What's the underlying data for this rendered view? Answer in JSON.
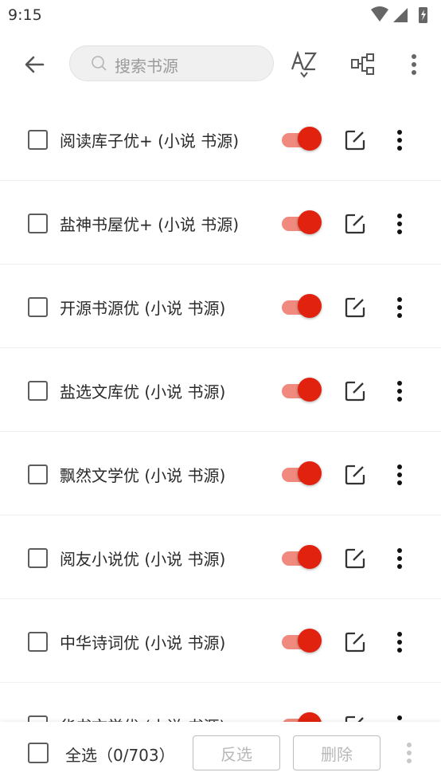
{
  "status_bar": {
    "time": "9:15"
  },
  "toolbar": {
    "search_placeholder": "搜索书源"
  },
  "sources": [
    {
      "name": "阅读库子优+ (小说 书源)",
      "enabled": true
    },
    {
      "name": "盐神书屋优+ (小说 书源)",
      "enabled": true
    },
    {
      "name": "开源书源优 (小说 书源)",
      "enabled": true
    },
    {
      "name": "盐选文库优 (小说 书源)",
      "enabled": true
    },
    {
      "name": "飘然文学优 (小说 书源)",
      "enabled": true
    },
    {
      "name": "阅友小说优 (小说 书源)",
      "enabled": true
    },
    {
      "name": "中华诗词优 (小说 书源)",
      "enabled": true
    },
    {
      "name": "华书文学优 (小说 书源)",
      "enabled": true
    }
  ],
  "bottom_bar": {
    "select_all": "全选（0/703）",
    "invert": "反选",
    "delete": "删除"
  },
  "colors": {
    "accent": "#e0220e",
    "track": "#f08a7e"
  }
}
